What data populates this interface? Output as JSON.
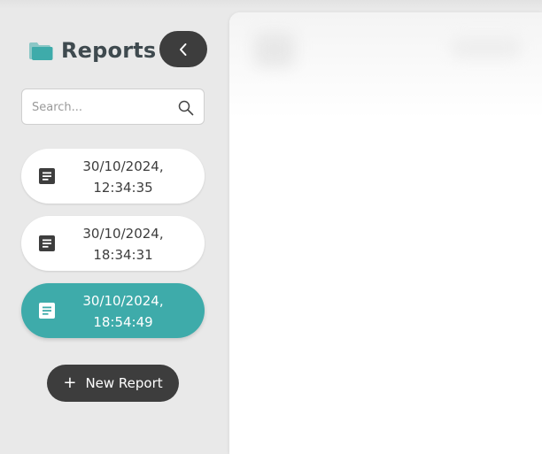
{
  "sidebar": {
    "title": "Reports",
    "search": {
      "placeholder": "Search...",
      "value": ""
    },
    "reports": [
      {
        "line1": "30/10/2024,",
        "line2": "12:34:35",
        "active": false
      },
      {
        "line1": "30/10/2024,",
        "line2": "18:34:31",
        "active": false
      },
      {
        "line1": "30/10/2024,",
        "line2": "18:54:49",
        "active": true
      }
    ],
    "new_report": {
      "plus": "+",
      "label": "New Report"
    }
  },
  "colors": {
    "accent": "#3eabaa",
    "dark_button": "#3d3d3d",
    "background": "#e9e9e9",
    "folder_icon": "#3eabaa"
  },
  "icons": {
    "folder": "folder-icon",
    "collapse": "chevron-left-icon",
    "search": "search-icon",
    "report": "document-icon",
    "add": "plus-icon"
  }
}
